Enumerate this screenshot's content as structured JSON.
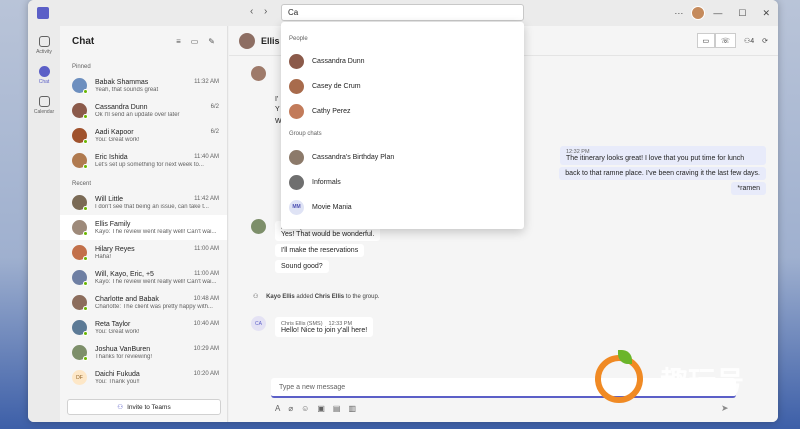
{
  "titlebar": {
    "back": "‹",
    "forward": "›",
    "search_value": "Ca",
    "more": "···",
    "minimize": "—",
    "maximize": "☐",
    "close": "✕"
  },
  "rail": [
    {
      "label": "Activity"
    },
    {
      "label": "Chat"
    },
    {
      "label": "Calendar"
    }
  ],
  "list": {
    "title": "Chat",
    "pinned_label": "Pinned",
    "recent_label": "Recent",
    "pinned": [
      {
        "name": "Babak Shammas",
        "time": "11:32 AM",
        "preview": "Yeah, that sounds great",
        "color": "#6d8fbf"
      },
      {
        "name": "Cassandra Dunn",
        "time": "6/2",
        "preview": "Ok I'll send an update over later",
        "color": "#8b5a4a"
      },
      {
        "name": "Aadi Kapoor",
        "time": "6/2",
        "preview": "You: Great work!",
        "color": "#a0522d"
      },
      {
        "name": "Eric Ishida",
        "time": "11:40 AM",
        "preview": "Let's set up something for next week to...",
        "color": "#b07a4f"
      }
    ],
    "recent": [
      {
        "name": "Will Little",
        "time": "11:42 AM",
        "preview": "I don't see that being an issue, can take t...",
        "color": "#7a6a55"
      },
      {
        "name": "Ellis Family",
        "time": "",
        "preview": "Kayo: The review went really well! Can't wai...",
        "color": "#9e8a7a"
      },
      {
        "name": "Hilary Reyes",
        "time": "11:00 AM",
        "preview": "Haha!",
        "color": "#c2704a"
      },
      {
        "name": "Will, Kayo, Eric, +5",
        "time": "11:00 AM",
        "preview": "Kayo: The review went really well! Can't wai...",
        "color": "#6e7fa3"
      },
      {
        "name": "Charlotte and Babak",
        "time": "10:48 AM",
        "preview": "Charlotte: The client was pretty happy with...",
        "color": "#8c6d5c"
      },
      {
        "name": "Reta Taylor",
        "time": "10:40 AM",
        "preview": "You: Great work!",
        "color": "#5c7a96"
      },
      {
        "name": "Joshua VanBuren",
        "time": "10:29 AM",
        "preview": "Thanks for reviewing!",
        "color": "#7d8f6a"
      },
      {
        "name": "Daichi Fukuda",
        "time": "10:20 AM",
        "preview": "You: Thank you!!",
        "initials": "DF"
      }
    ],
    "invite": "Invite to Teams"
  },
  "chat": {
    "title": "Ellis",
    "people_count": "4",
    "messages_left_top": [
      {
        "text": "I'"
      },
      {
        "text": "Y"
      },
      {
        "text": "W"
      }
    ],
    "mine": {
      "time": "12:32 PM",
      "lines": [
        "The itinerary looks great! I love that you put time for lunch",
        "back to that ramne place. I've been craving it the last few days.",
        "*ramen"
      ]
    },
    "reta": {
      "sender": "Reta Taylor",
      "time": "12:32 PM",
      "lines": [
        "Yes! That would be wonderful.",
        "I'll make the reservations",
        "Sound good?"
      ]
    },
    "system": {
      "actor": "Kayo Ellis",
      "mid": "added",
      "target": "Chris Ellis",
      "tail": "to the group."
    },
    "sms": {
      "initials": "CA",
      "sender": "Chris Ellis (SMS)",
      "time": "12:33 PM",
      "text": "Hello! Nice to join y'all here!"
    },
    "composer_placeholder": "Type a new message"
  },
  "dropdown": {
    "people_label": "People",
    "people": [
      {
        "name": "Cassandra Dunn",
        "color": "#8b5a4a"
      },
      {
        "name": "Casey de Crum",
        "color": "#a86b4c"
      },
      {
        "name": "Cathy Perez",
        "color": "#c27b5a"
      }
    ],
    "groups_label": "Group chats",
    "groups": [
      {
        "name": "Cassandra's Birthday Plan",
        "color": "#8c7a6a"
      },
      {
        "name": "Informals",
        "color": "#6f6f6f"
      },
      {
        "name": "Movie Mania",
        "initials": "MM"
      }
    ]
  },
  "watermark": {
    "text": "趣玩号"
  }
}
